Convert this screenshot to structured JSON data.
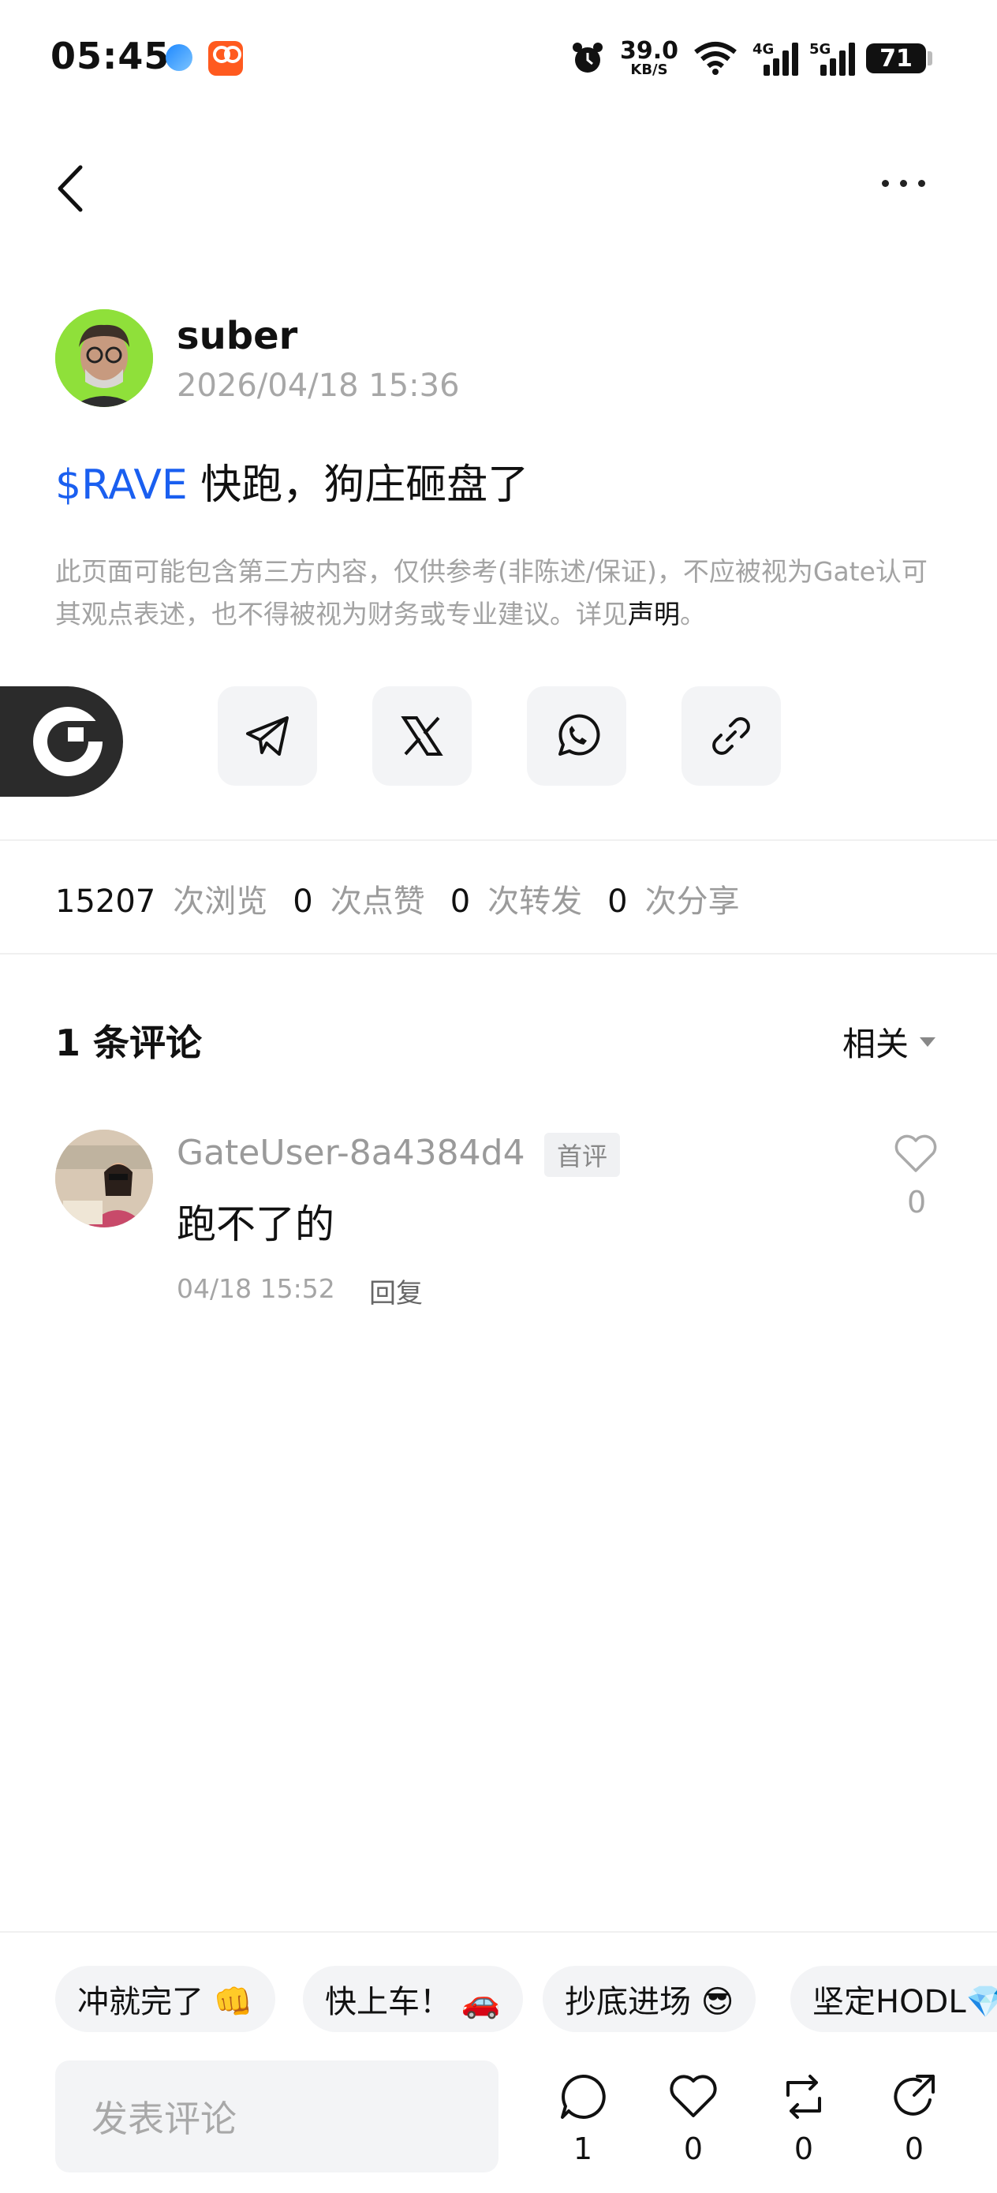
{
  "status_bar": {
    "time": "05:45",
    "speed_value": "39.0",
    "speed_unit": "KB/S",
    "net1": "4G",
    "net2": "5G",
    "battery": "71"
  },
  "post": {
    "author": "suber",
    "time": "2026/04/18 15:36",
    "tag": "$RAVE",
    "text": " 快跑，狗庄砸盘了",
    "disclaimer": "此页面可能包含第三方内容，仅供参考(非陈述/保证)，不应被视为Gate认可其观点表述，也不得被视为财务或专业建议。详见",
    "disclaimer_link": "声明",
    "disclaimer_end": "。"
  },
  "stats": {
    "views": "15207",
    "views_label": "次浏览",
    "likes": "0",
    "likes_label": "次点赞",
    "reposts": "0",
    "reposts_label": "次转发",
    "shares": "0",
    "shares_label": "次分享"
  },
  "comments": {
    "title": "1 条评论",
    "sort_label": "相关",
    "items": [
      {
        "user": "GateUser-8a4384d4",
        "badge": "首评",
        "text": "跑不了的",
        "time": "04/18 15:52",
        "reply": "回复",
        "likes": "0"
      }
    ]
  },
  "quick_replies": [
    "冲就完了 👊",
    "快上车！ 🚗",
    "抄底进场 😎",
    "坚定HODL💎"
  ],
  "bottom": {
    "input_placeholder": "发表评论",
    "comment_count": "1",
    "like_count": "0",
    "repost_count": "0",
    "share_count": "0"
  },
  "colors": {
    "accent": "#1a5ff0",
    "avatar_bg": "#8fe03a"
  }
}
